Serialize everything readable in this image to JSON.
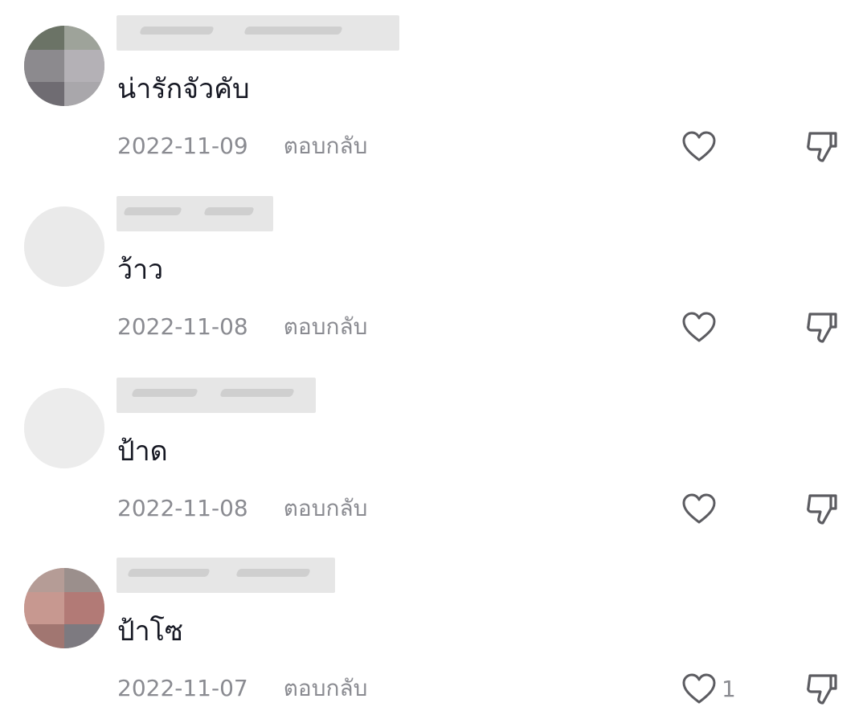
{
  "comments": [
    {
      "text": "น่ารักจัวคับ",
      "date": "2022-11-09",
      "reply_label": "ตอบกลับ",
      "like_icon": "heart-outline-icon",
      "dislike_icon": "thumbs-down-icon",
      "like_count": ""
    },
    {
      "text": "ว้าว",
      "date": "2022-11-08",
      "reply_label": "ตอบกลับ",
      "like_icon": "heart-outline-icon",
      "dislike_icon": "thumbs-down-icon",
      "like_count": ""
    },
    {
      "text": "ป้าด",
      "date": "2022-11-08",
      "reply_label": "ตอบกลับ",
      "like_icon": "heart-outline-icon",
      "dislike_icon": "thumbs-down-icon",
      "like_count": ""
    },
    {
      "text": "ป้าโซ",
      "date": "2022-11-07",
      "reply_label": "ตอบกลับ",
      "like_icon": "heart-outline-icon",
      "dislike_icon": "thumbs-down-icon",
      "like_count": "1"
    }
  ],
  "colors": {
    "text_primary": "#161823",
    "text_secondary": "#8a8b91",
    "icon": "#5c5c61",
    "background": "#ffffff"
  }
}
